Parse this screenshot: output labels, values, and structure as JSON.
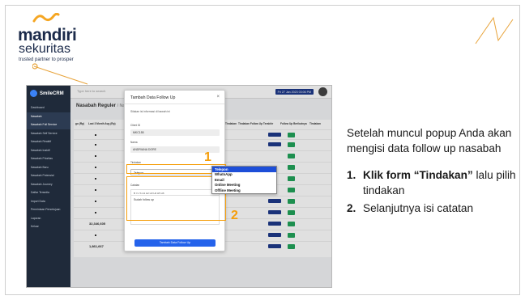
{
  "brand": {
    "name": "mandiri",
    "product": "sekuritas",
    "tagline": "trusted partner to prosper"
  },
  "crm": {
    "app_name": "SmileCRM",
    "search_placeholder": "Type here to search",
    "date_badge": "Fri 27 Jan 2023 03:06 PM",
    "page_title": "Nasabah Reguler",
    "breadcrumb": "/ Nasabah",
    "menu": [
      "Dashboard",
      "Nasabah",
      "Nasabah Full Service",
      "Nasabah Self Service",
      "Nasabah Reaktif",
      "Nasabah Inaktif",
      "Nasabah Prioritas",
      "Nasabah Baru",
      "Nasabah Potensial",
      "Nasabah Journey",
      "Daftar Tersedia",
      "Import Data",
      "Permintaan Persetujuan",
      "Laporan",
      "Keluar"
    ],
    "table_headers": [
      "go (Rp)",
      "Last 3 Month Avg (Rp)",
      "Tindakan",
      "Tindakan Follow Up Terakhir",
      "Follow Up Berikutnya",
      "Tindakan"
    ],
    "row_values": [
      "",
      "",
      "",
      "",
      "",
      "",
      "",
      "",
      "",
      "32,346,605",
      "",
      "1,861,667"
    ]
  },
  "modal": {
    "title": "Tambah Data Follow Up",
    "subtitle": "Silakan isi informasi di bawah ini",
    "client_id_label": "Client ID",
    "client_id_value": "MKC155",
    "name_label": "Nama",
    "name_value": "ANDRIANA DORE",
    "action_label": "Tindakan",
    "action_value": "Telepon",
    "notes_label": "Catatan",
    "notes_toolbar": "B I U S H1 H2 H3 H4 H5 H6",
    "notes_value": "Sudah follow up",
    "submit_label": "Tambah Data Follow Up",
    "options": [
      "Telepon",
      "WhatsApp",
      "Email",
      "Online Meeting",
      "Offline Meeting"
    ]
  },
  "callouts": [
    "1",
    "2"
  ],
  "instructions": {
    "intro": "Setelah muncul popup Anda akan mengisi data follow up nasabah",
    "steps": [
      {
        "num": "1.",
        "bold": "Klik form “Tindakan”",
        "rest": " lalu pilih tindakan"
      },
      {
        "num": "2.",
        "bold": "",
        "rest": "Selanjutnya isi catatan"
      }
    ]
  },
  "colors": {
    "accent": "#f59e0b",
    "brand_navy": "#1b2a4a",
    "sidebar": "#1f2a3a",
    "primary_blue": "#2563eb"
  }
}
